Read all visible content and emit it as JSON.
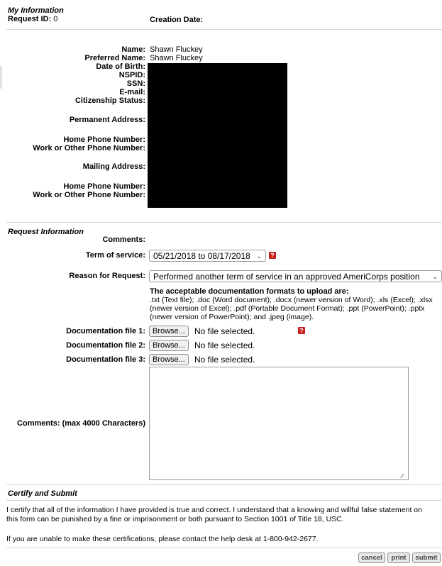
{
  "my_info": {
    "heading": "My Information",
    "request_id_label": "Request ID:",
    "request_id_value": "0",
    "creation_date_label": "Creation Date:",
    "fields": [
      {
        "label": "Name:",
        "value": "Shawn Fluckey"
      },
      {
        "label": "Preferred Name:",
        "value": "Shawn Fluckey"
      },
      {
        "label": "Date of Birth:",
        "value": ""
      },
      {
        "label": "NSPID:",
        "value": ""
      },
      {
        "label": "SSN:",
        "value": ""
      },
      {
        "label": "E-mail:",
        "value": ""
      },
      {
        "label": "Citizenship Status:",
        "value": ""
      },
      {
        "label": "Permanent Address:",
        "value": ""
      },
      {
        "label": "Home Phone Number:",
        "value": ""
      },
      {
        "label": "Work or Other Phone Number:",
        "value": ""
      },
      {
        "label": "Mailing Address:",
        "value": ""
      },
      {
        "label": "Home Phone Number:",
        "value": ""
      },
      {
        "label": "Work or Other Phone Number:",
        "value": ""
      }
    ]
  },
  "request_info": {
    "heading": "Request Information",
    "comments_label": "Comments:",
    "term_label": "Term of service:",
    "term_value": "05/21/2018 to 08/17/2018",
    "reason_label": "Reason for Request:",
    "reason_value": "Performed another term of service in an approved AmeriCorps position",
    "docs_heading": "The acceptable documentation formats to upload are:",
    "docs_text": ".txt (Text file); .doc (Word document); .docx (newer version of Word); .xls (Excel); .xlsx (newer version of Excel); .pdf (Portable Document Format); .ppt (PowerPoint); .pptx (newer version of PowerPoint); and .jpeg (image).",
    "files": [
      {
        "label": "Documentation file 1:",
        "browse": "Browse...",
        "status": "No file selected."
      },
      {
        "label": "Documentation file 2:",
        "browse": "Browse...",
        "status": "No file selected."
      },
      {
        "label": "Documentation file 3:",
        "browse": "Browse...",
        "status": "No file selected."
      }
    ],
    "comments_max_label": "Comments: (max 4000 Characters)",
    "help_glyph": "?"
  },
  "certify": {
    "heading": "Certify and Submit",
    "statement": "I certify that all of the information I have provided is true and correct. I understand that a knowing and willful false statement on this form can be punished by a fine or imprisonment or both pursuant to Section 1001 of Title 18, USC.",
    "help_text": "If you are unable to make these certifications, please contact the help desk at 1-800-942-2677."
  },
  "buttons": {
    "cancel": "cancel",
    "print": "print",
    "submit": "submit"
  },
  "colors": {
    "help_icon": "#c81e1e",
    "redaction": "#000000"
  }
}
